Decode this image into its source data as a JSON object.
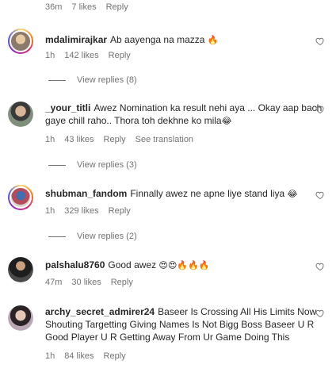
{
  "top": {
    "time": "36m",
    "likes": "7 likes",
    "reply": "Reply"
  },
  "comments": [
    {
      "username": "mdalimirajkar",
      "text": "Ab aayenga na mazza",
      "emoji": "🔥",
      "time": "1h",
      "likes": "142 likes",
      "reply": "Reply",
      "view_replies": "View replies (8)"
    },
    {
      "username": "_your_titli",
      "text": "Awez Nomination ka result nehi aya ... Okay aap bach gaye chill raho.. Thora toh dekhne ko mila",
      "emoji": "😂",
      "time": "1h",
      "likes": "43 likes",
      "reply": "Reply",
      "translation": "See translation",
      "view_replies": "View replies (3)"
    },
    {
      "username": "shubman_fandom",
      "text": "Finnally awez ne apne liye stand liya",
      "emoji": "😂",
      "time": "1h",
      "likes": "329 likes",
      "reply": "Reply",
      "view_replies": "View replies (2)"
    },
    {
      "username": "palshalu8760",
      "text": "Good awez",
      "emoji": "😍😍🔥🔥🔥",
      "time": "47m",
      "likes": "30 likes",
      "reply": "Reply"
    },
    {
      "username": "archy_secret_admirer24",
      "text": "Baseer Is Crossing All His Limits Now Shouting Targetting Giving Names Is Not Bigg Boss Baseer U R Good Player U R Getting Away From Ur Game Doing This",
      "time": "1h",
      "likes": "84 likes",
      "reply": "Reply"
    }
  ],
  "icons": {
    "like": "heart-outline-icon"
  },
  "colors": {
    "text": "#262626",
    "muted": "#737373"
  }
}
